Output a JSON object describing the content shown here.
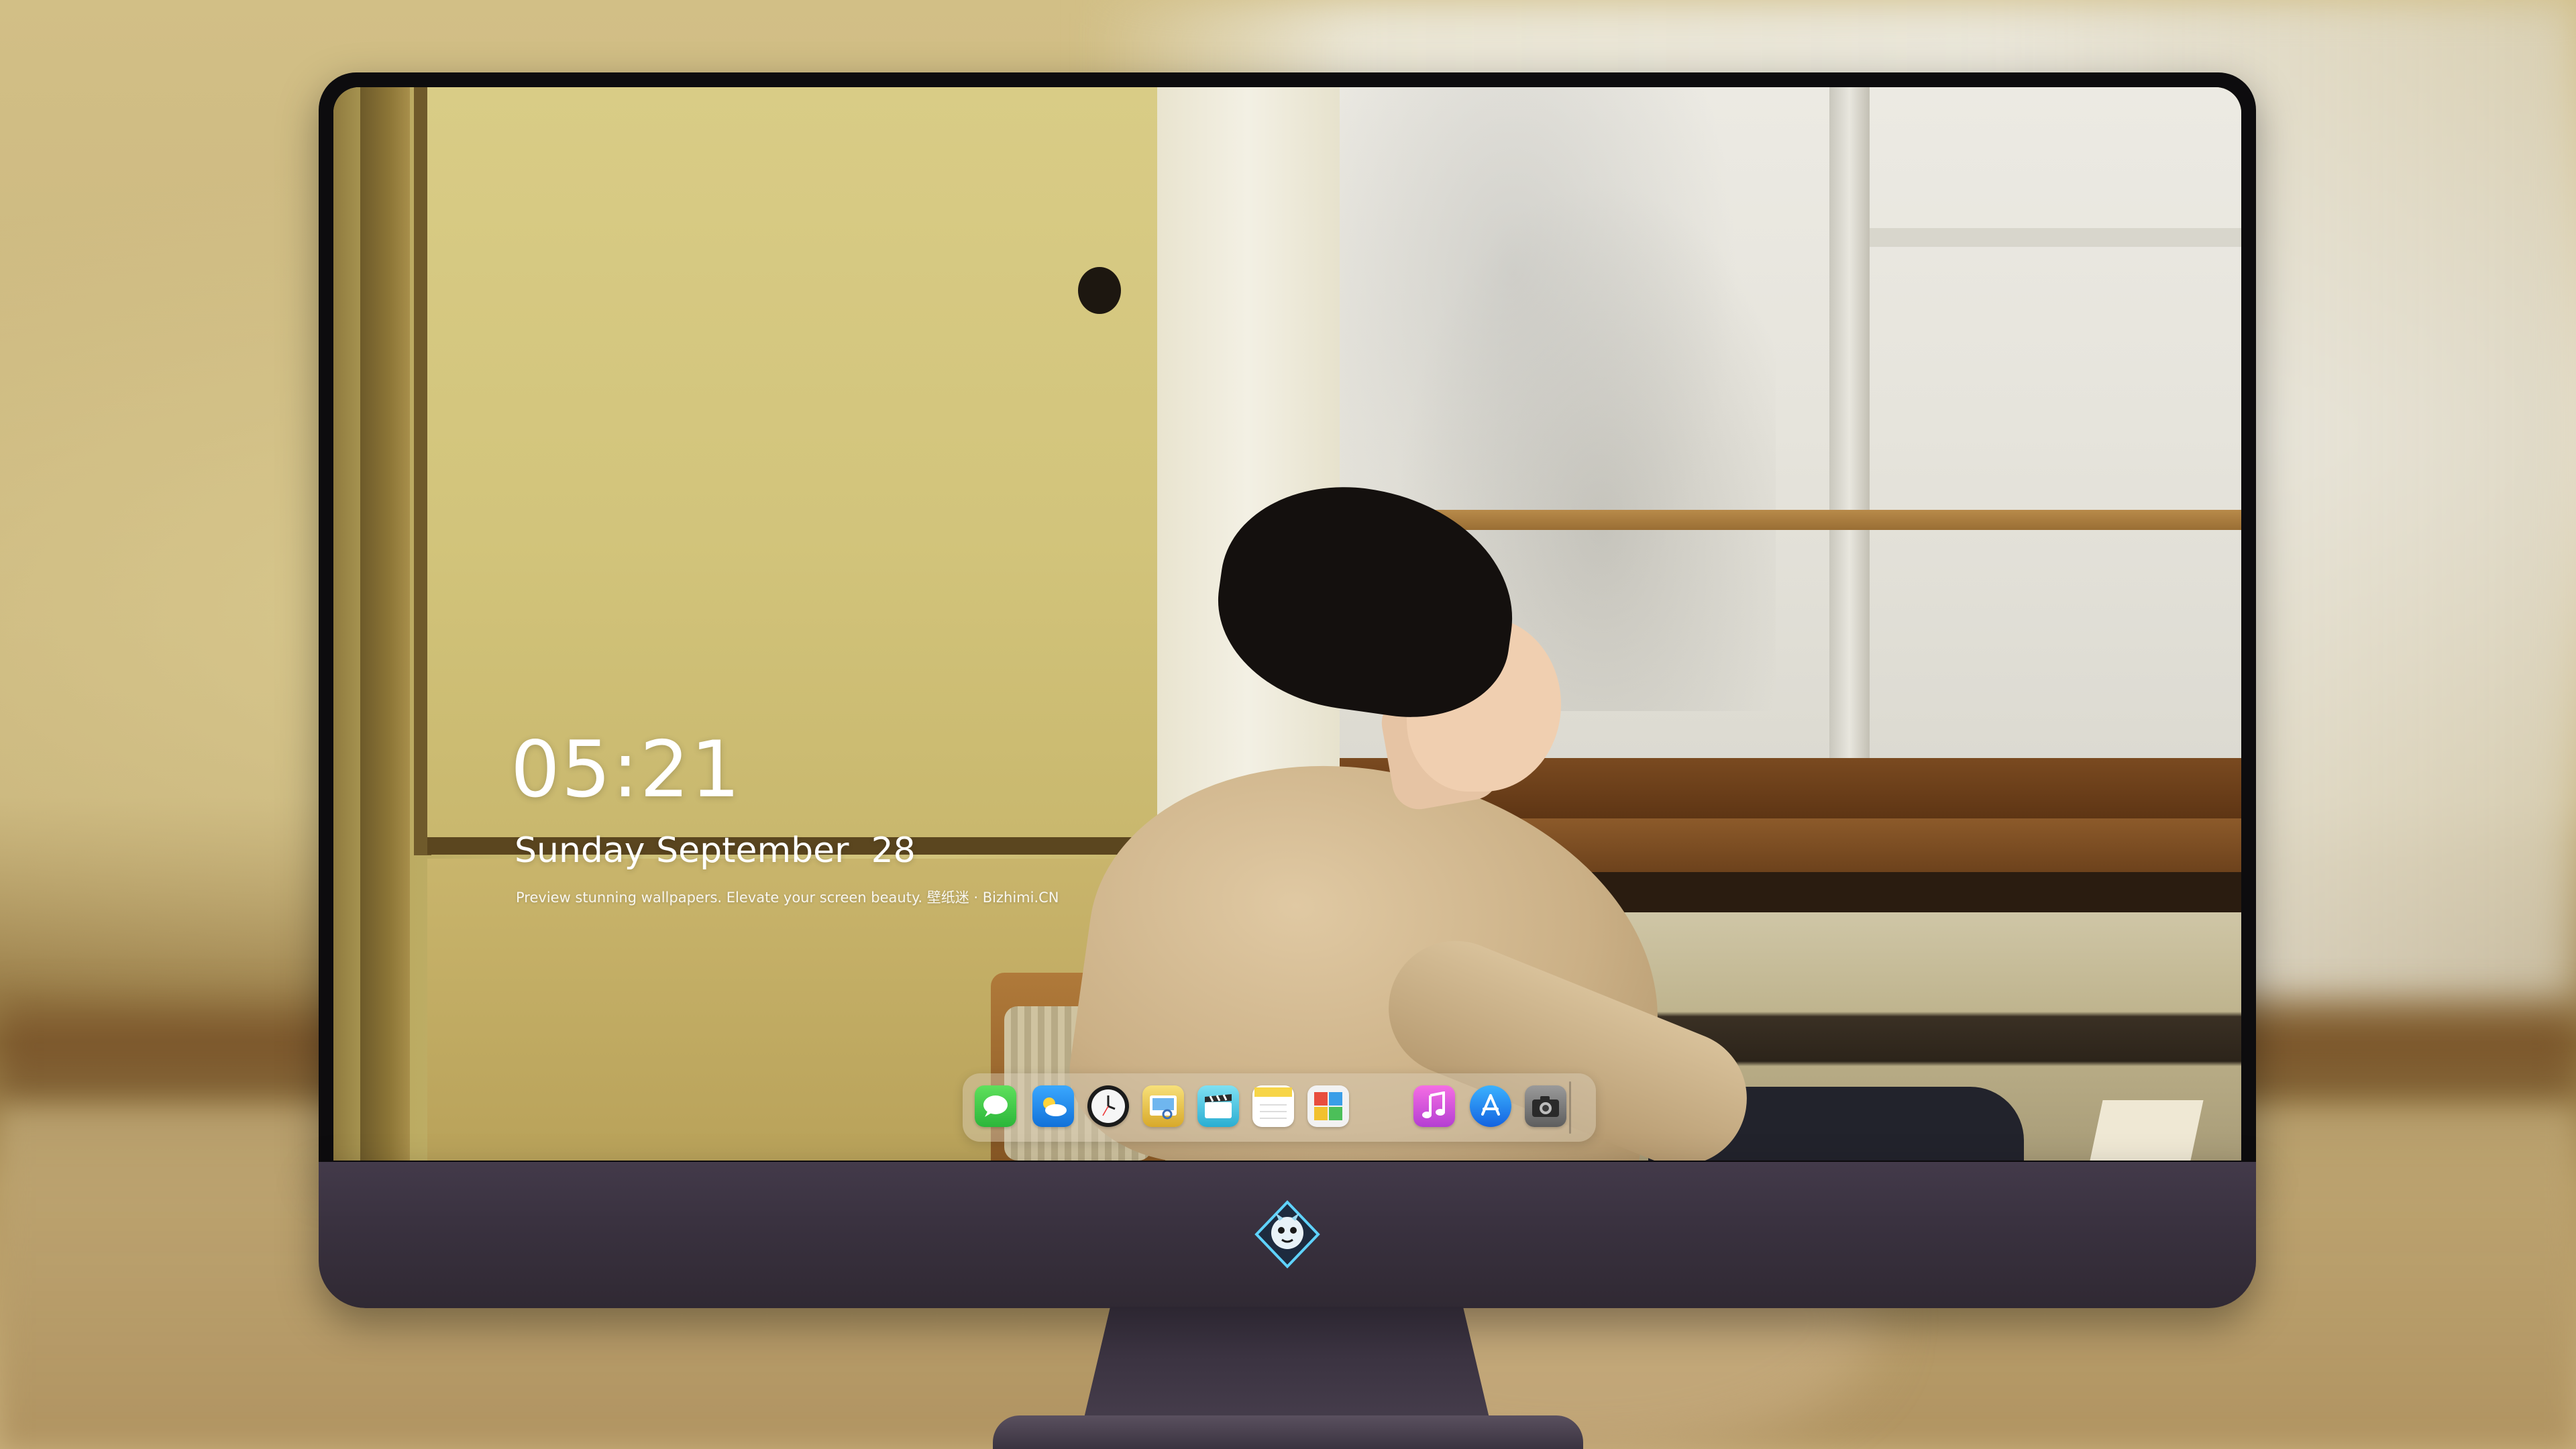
{
  "lock_screen": {
    "time": "05:21",
    "date": "Sunday September  28",
    "tagline": "Preview stunning wallpapers. Elevate your screen beauty. 壁纸迷 · Bizhimi.CN"
  },
  "dock": {
    "apps": [
      {
        "name": "Messages",
        "icon": "messages-icon",
        "color": "#3ac94a"
      },
      {
        "name": "Weather",
        "icon": "weather-icon",
        "color": "#1e8ff0"
      },
      {
        "name": "Clock",
        "icon": "clock-icon",
        "color": "#f4f4f4"
      },
      {
        "name": "Preview",
        "icon": "preview-icon",
        "color": "#e9c449"
      },
      {
        "name": "Clips",
        "icon": "clapper-icon",
        "color": "#47c6e6"
      },
      {
        "name": "Notes",
        "icon": "notes-icon",
        "color": "#f7d547"
      },
      {
        "name": "Photo Booth",
        "icon": "photo-booth-icon",
        "color": "#f0f0f0"
      },
      {
        "name": "iTunes",
        "icon": "music-note-icon",
        "color": "#e64bd6"
      },
      {
        "name": "App Store",
        "icon": "app-store-icon",
        "color": "#2a8df4"
      },
      {
        "name": "Camera",
        "icon": "camera-icon",
        "color": "#7b7b7b"
      }
    ]
  },
  "monitor": {
    "logo": "dragon-mascot-icon",
    "bezel_color": "#0d0c0e",
    "chin_color": "#3a3240"
  }
}
